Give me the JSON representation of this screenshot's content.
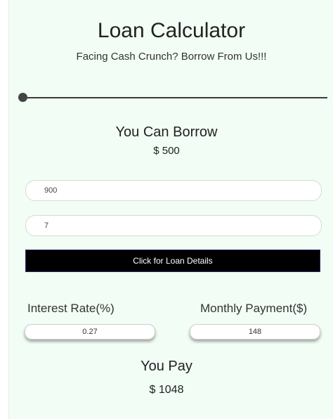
{
  "header": {
    "title": "Loan Calculator",
    "subtitle": "Facing Cash Crunch? Borrow From Us!!!"
  },
  "slider": {
    "level_fraction": 0.0
  },
  "borrow": {
    "label": "You Can Borrow",
    "value": "$ 500"
  },
  "inputs": {
    "amount": "900",
    "months": "7"
  },
  "button": {
    "label": "Click for Loan Details"
  },
  "results": {
    "interest_label": "Interest Rate(%)",
    "interest_value": "0.27",
    "payment_label": "Monthly Payment($)",
    "payment_value": "148",
    "pay_label": "You Pay",
    "pay_value": "$ 1048"
  },
  "colors": {
    "panel_bg": "#f1fdf5",
    "button_bg": "#000000",
    "button_text": "#ffffff"
  }
}
